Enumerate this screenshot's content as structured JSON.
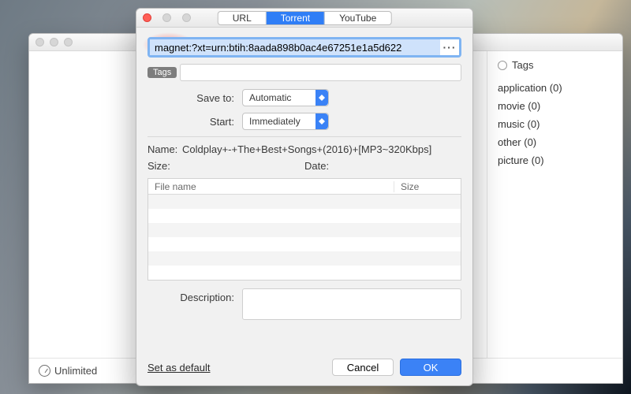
{
  "parent": {
    "sidebar": {
      "radio_label": "Tags",
      "tags": [
        {
          "label": "application (0)"
        },
        {
          "label": "movie (0)"
        },
        {
          "label": "music (0)"
        },
        {
          "label": "other (0)"
        },
        {
          "label": "picture (0)"
        }
      ]
    },
    "status": {
      "speed_label": "Unlimited"
    }
  },
  "modal": {
    "tabs": {
      "url": "URL",
      "torrent": "Torrent",
      "youtube": "YouTube",
      "active": "torrent"
    },
    "url_value": "magnet:?xt=urn:btih:8aada898b0ac4e67251e1a5d622",
    "tags_badge": "Tags",
    "tags_value": "",
    "save_to": {
      "label": "Save to:",
      "value": "Automatic"
    },
    "start": {
      "label": "Start:",
      "value": "Immediately"
    },
    "name": {
      "label": "Name:",
      "value": "Coldplay+-+The+Best+Songs+(2016)+[MP3~320Kbps]"
    },
    "size": {
      "label": "Size:",
      "value": ""
    },
    "date": {
      "label": "Date:",
      "value": ""
    },
    "table": {
      "col_file": "File name",
      "col_size": "Size"
    },
    "description": {
      "label": "Description:",
      "value": ""
    },
    "footer": {
      "set_default": "Set as default",
      "cancel": "Cancel",
      "ok": "OK"
    }
  }
}
